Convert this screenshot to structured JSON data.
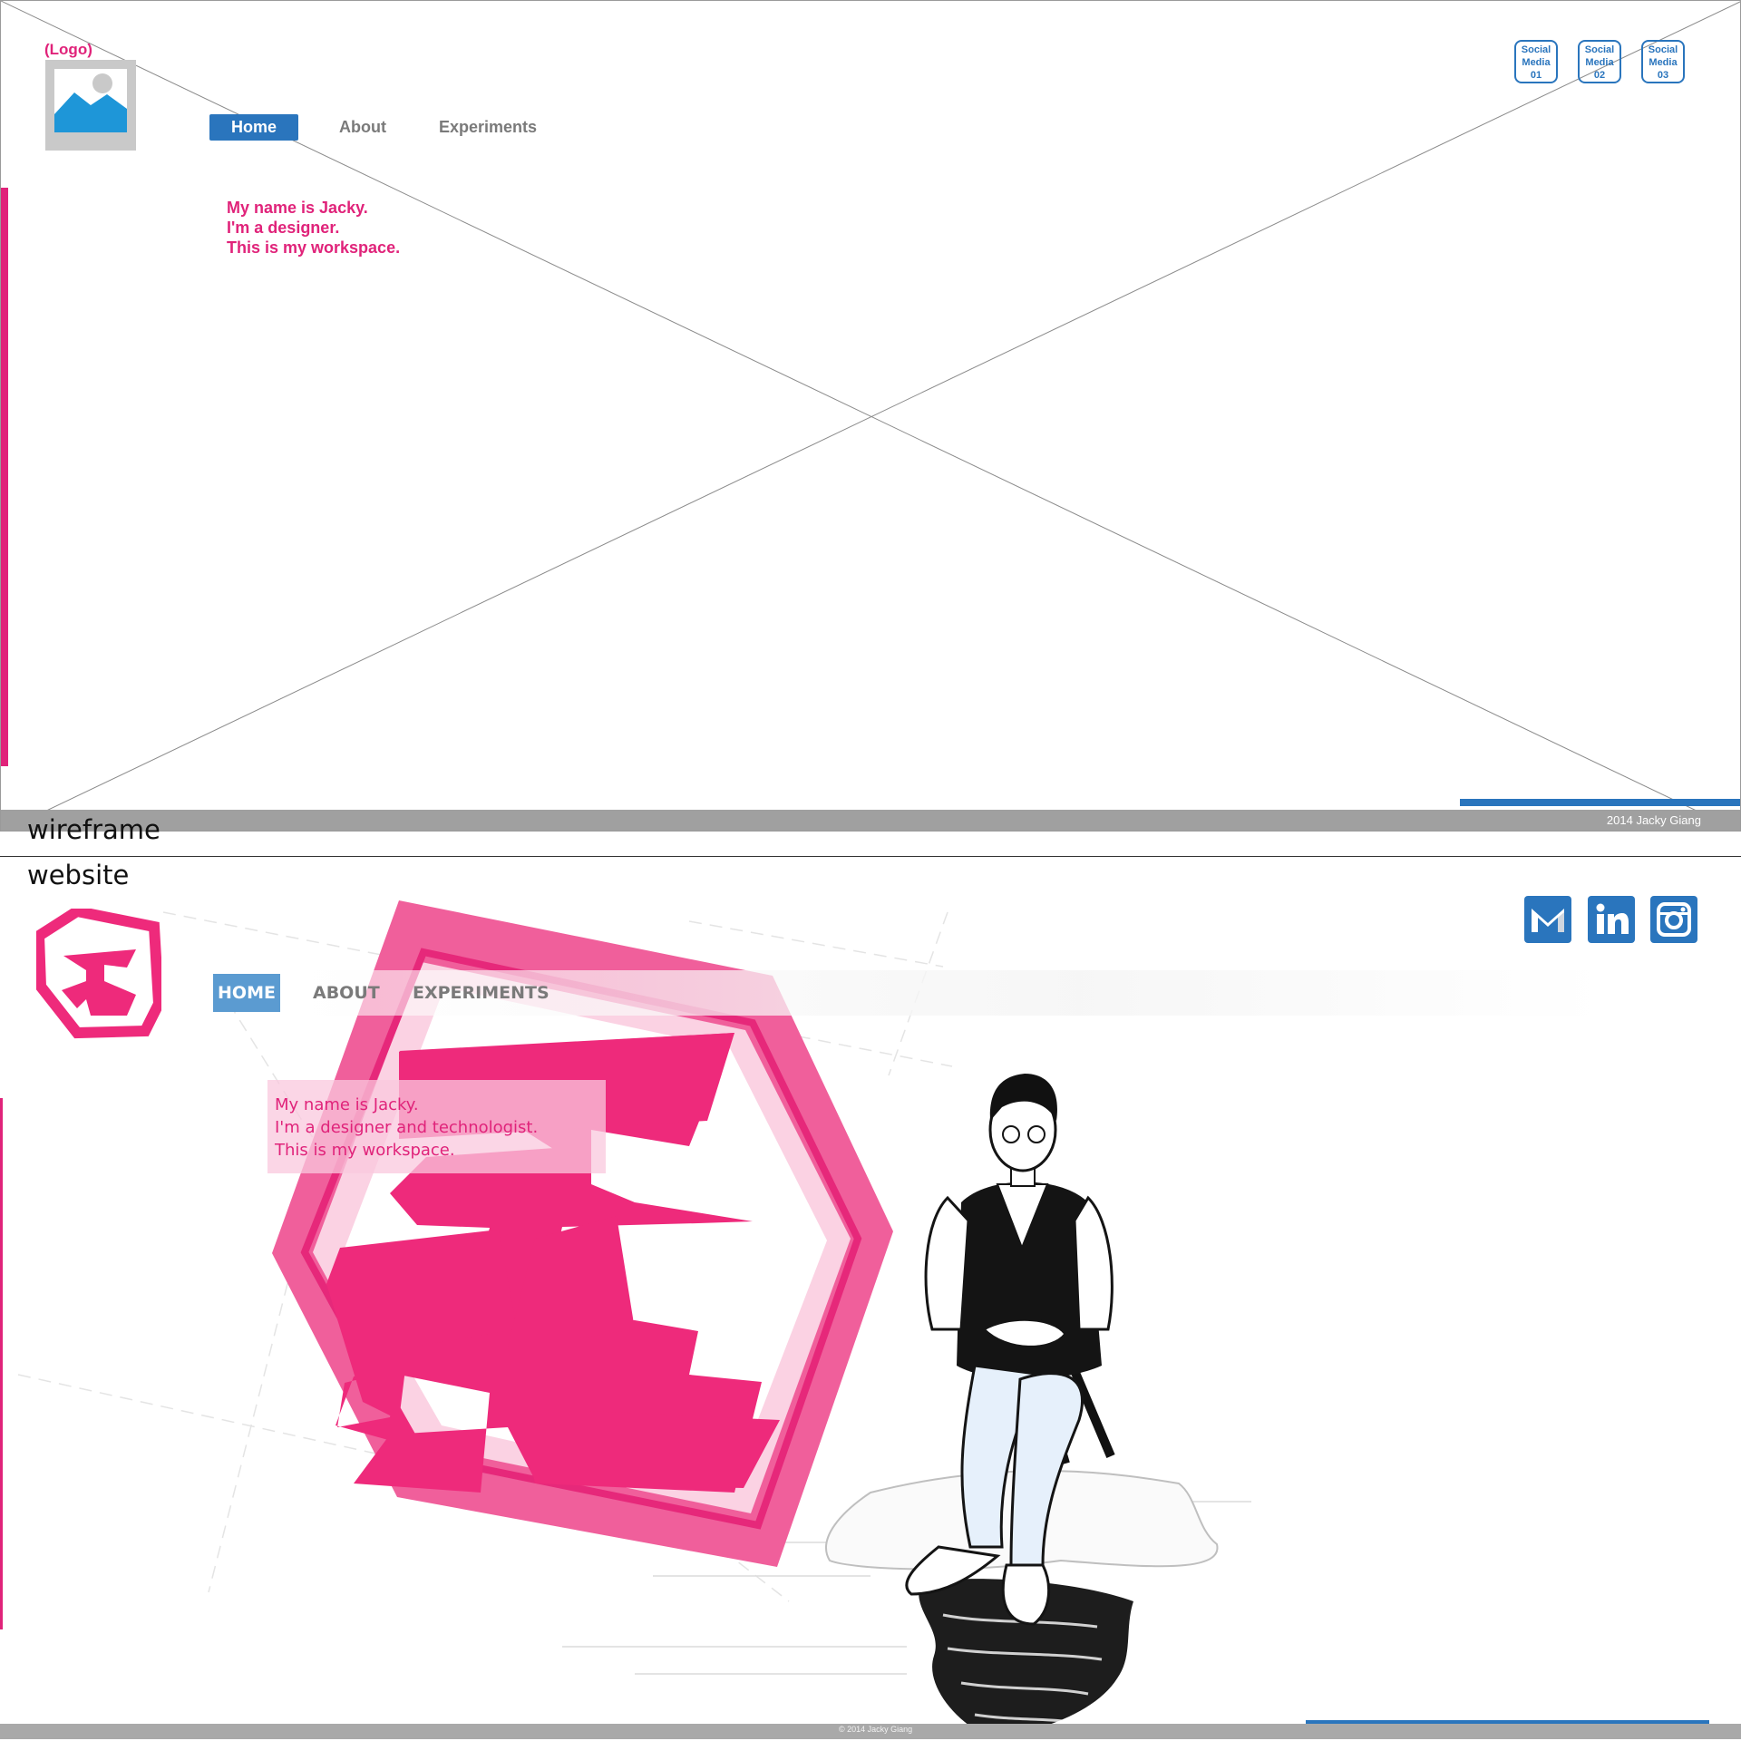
{
  "wireframe": {
    "logo_label": "(Logo)",
    "nav": [
      "Home",
      "About",
      "Experiments"
    ],
    "intro": [
      "My name is Jacky.",
      "I'm a designer.",
      "This is my workspace."
    ],
    "social": [
      {
        "lines": [
          "Social",
          "Media",
          "01"
        ]
      },
      {
        "lines": [
          "Social",
          "Media",
          "02"
        ]
      },
      {
        "lines": [
          "Social",
          "Media",
          "03"
        ]
      }
    ],
    "footer": "2014 Jacky Giang"
  },
  "captions": {
    "wireframe": "wireframe",
    "website": "website"
  },
  "website": {
    "nav": [
      "HOME",
      "ABOUT",
      "EXPERIMENTS"
    ],
    "intro": [
      "My name is Jacky.",
      "I'm a designer and technologist.",
      "This is my workspace."
    ],
    "social_icons": [
      "mail-icon",
      "linkedin-icon",
      "instagram-icon"
    ],
    "footer": "© 2014 Jacky Giang"
  },
  "colors": {
    "pink": "#e0237a",
    "blue": "#2a75bd",
    "nav_active_site": "#5b9bd1",
    "footer_gray": "#a0a0a0"
  }
}
